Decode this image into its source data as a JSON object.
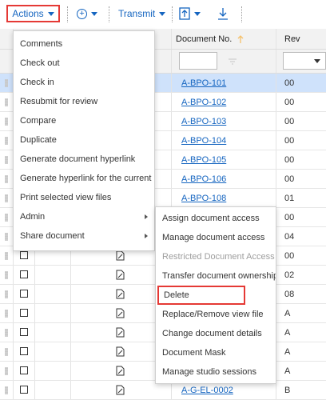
{
  "toolbar": {
    "actions_label": "Actions",
    "add_label": "+",
    "transmit_label": "Transmit"
  },
  "columns": {
    "doc_no": "Document No.",
    "rev": "Rev"
  },
  "rows": [
    {
      "doc": "A-BPO-101",
      "rev": "00"
    },
    {
      "doc": "A-BPO-102",
      "rev": "00"
    },
    {
      "doc": "A-BPO-103",
      "rev": "00"
    },
    {
      "doc": "A-BPO-104",
      "rev": "00"
    },
    {
      "doc": "A-BPO-105",
      "rev": "00"
    },
    {
      "doc": "A-BPO-106",
      "rev": "00"
    },
    {
      "doc": "A-BPO-108",
      "rev": "01"
    },
    {
      "doc": "",
      "rev": "00"
    },
    {
      "doc": "",
      "rev": "04"
    },
    {
      "doc": "",
      "rev": "00"
    },
    {
      "doc": "",
      "rev": "02"
    },
    {
      "doc": "",
      "rev": "08"
    },
    {
      "doc": "",
      "rev": "A"
    },
    {
      "doc": "",
      "rev": "A"
    },
    {
      "doc": "",
      "rev": "A"
    },
    {
      "doc": "",
      "rev": "A"
    },
    {
      "doc": "A-G-EL-0002",
      "rev": "B"
    }
  ],
  "actions_menu": [
    "Comments",
    "Check out",
    "Check in",
    "Resubmit for review",
    "Compare",
    "Duplicate",
    "Generate document hyperlink",
    "Generate hyperlink for the current r...",
    "Print selected view files",
    "Admin",
    "Share document"
  ],
  "admin_menu": [
    "Assign document access",
    "Manage document access",
    "Restricted Document Access",
    "Transfer document ownership",
    "Delete",
    "Replace/Remove view file",
    "Change document details",
    "Document Mask",
    "Manage studio sessions"
  ],
  "colors": {
    "accent": "#1565c0",
    "highlight": "#e53935",
    "selected_row": "#cfe2fb"
  }
}
